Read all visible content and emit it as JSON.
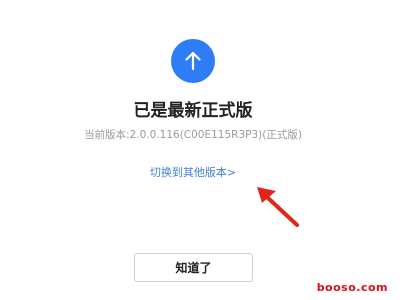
{
  "dialog": {
    "title": "已是最新正式版",
    "version_text": "当前版本:2.0.0.116(C00E115R3P3)(正式版)",
    "switch_link_text": "切换到其他版本>",
    "ok_button_label": "知道了"
  },
  "watermark": {
    "text": "booso.com"
  },
  "colors": {
    "accent": "#2f7df6",
    "link": "#3f82d6",
    "annotation_arrow": "#e0251b"
  },
  "icons": {
    "update": "arrow-up-icon",
    "annotation": "red-arrow-icon"
  }
}
